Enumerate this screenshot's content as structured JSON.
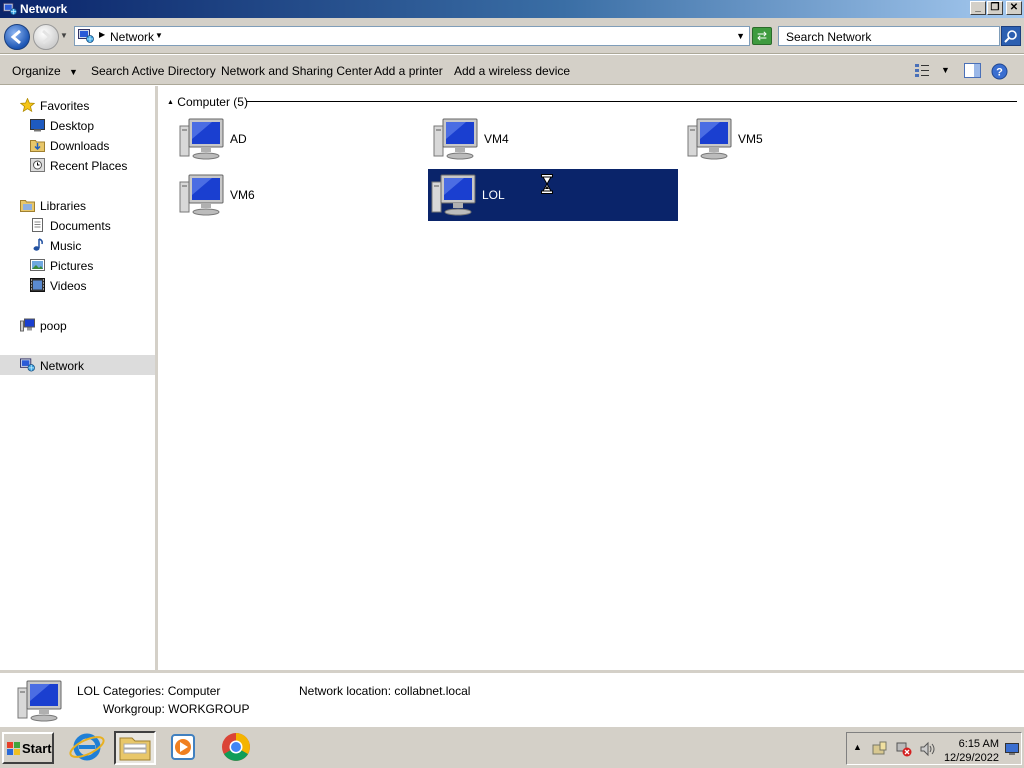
{
  "window": {
    "title": "Network",
    "controls": {
      "minimize": "_",
      "restore": "❐",
      "close": "✕"
    }
  },
  "address": {
    "breadcrumb": "Network",
    "search_placeholder": "Search Network"
  },
  "toolbar": {
    "organize": "Organize",
    "search_ad": "Search Active Directory",
    "network_sharing": "Network and Sharing Center",
    "add_printer": "Add a printer",
    "add_wireless": "Add a wireless device"
  },
  "sidebar": {
    "favorites": "Favorites",
    "desktop": "Desktop",
    "downloads": "Downloads",
    "recent": "Recent Places",
    "libraries": "Libraries",
    "documents": "Documents",
    "music": "Music",
    "pictures": "Pictures",
    "videos": "Videos",
    "computer": "poop",
    "network": "Network"
  },
  "content": {
    "group_header": "Computer (5)",
    "computers": [
      "AD",
      "VM4",
      "VM5",
      "VM6",
      "LOL"
    ],
    "selected": "LOL"
  },
  "details": {
    "name": "LOL",
    "categories": "Categories: Computer",
    "workgroup": "Workgroup: WORKGROUP",
    "location": "Network location: collabnet.local"
  },
  "taskbar": {
    "start": "Start",
    "time": "6:15 AM",
    "date": "12/29/2022"
  },
  "colors": {
    "selection": "#0a246a",
    "chrome": "#d4d0c8",
    "titlebar_start": "#0a246a",
    "titlebar_end": "#a6caf0"
  }
}
